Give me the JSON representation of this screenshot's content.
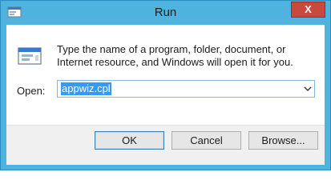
{
  "window": {
    "title": "Run",
    "close_label": "X",
    "icons": {
      "app": "run-icon",
      "close": "close-icon",
      "dropdown": "chevron-down-icon"
    },
    "colors": {
      "frame": "#4fb3e0",
      "close": "#c74a3d",
      "selection": "#3399ff"
    }
  },
  "body": {
    "description": "Type the name of a program, folder, document, or Internet resource, and Windows will open it for you.",
    "open_label": "Open:",
    "open_value": "appwiz.cpl"
  },
  "buttons": {
    "ok": "OK",
    "cancel": "Cancel",
    "browse": "Browse..."
  }
}
